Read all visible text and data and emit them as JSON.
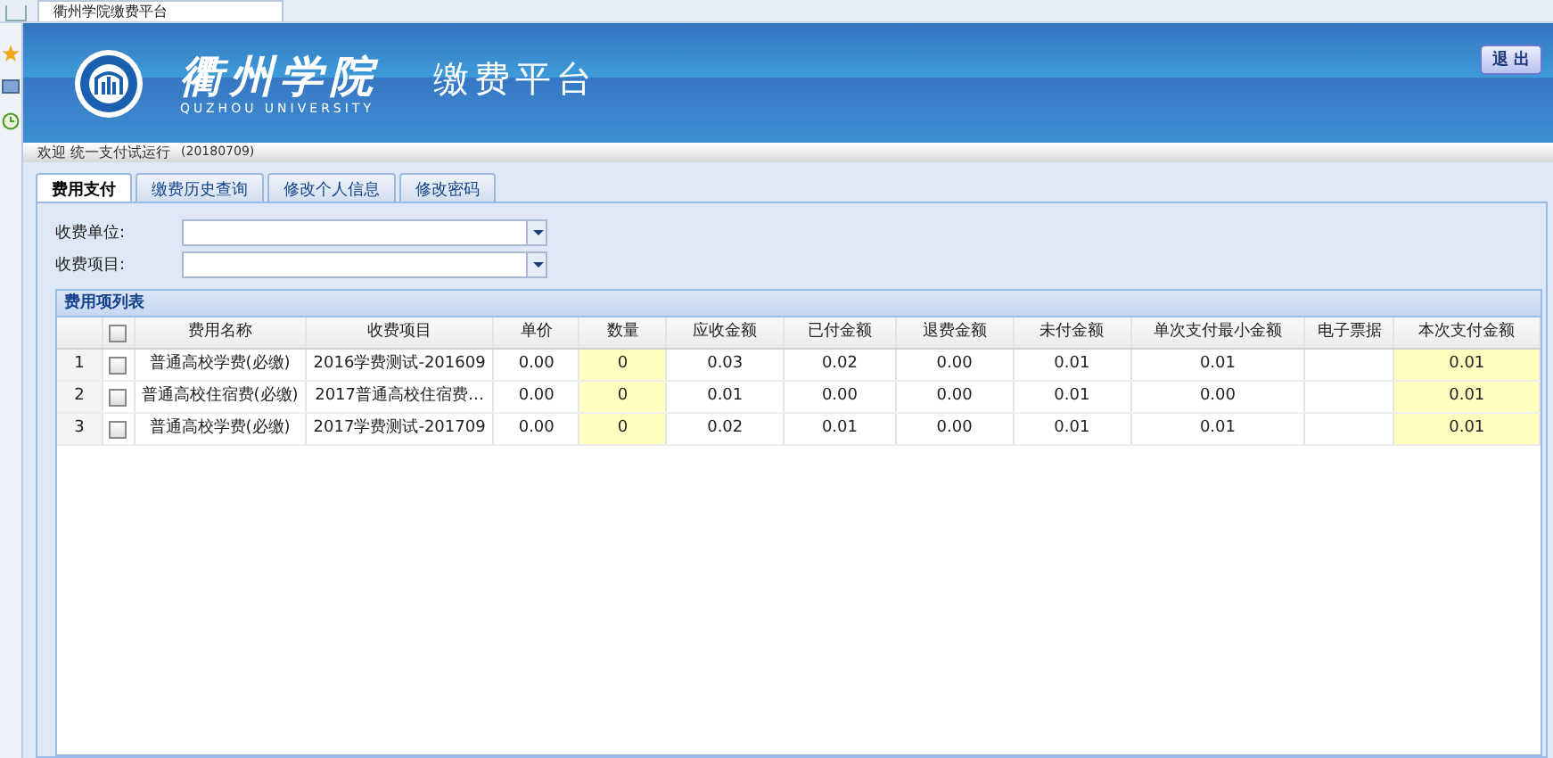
{
  "browser_tab": {
    "title": "衢州学院缴费平台"
  },
  "header": {
    "school_name": "衢州学院",
    "school_name_en": "QUZHOU  UNIVERSITY",
    "platform": "缴费平台",
    "logout": "退 出"
  },
  "welcome": {
    "text": "欢迎  统一支付试运行",
    "code": "(20180709)"
  },
  "tabs": [
    {
      "label": "费用支付",
      "selected": true
    },
    {
      "label": "缴费历史查询",
      "selected": false
    },
    {
      "label": "修改个人信息",
      "selected": false
    },
    {
      "label": "修改密码",
      "selected": false
    }
  ],
  "filters": [
    {
      "label": "收费单位:"
    },
    {
      "label": "收费项目:"
    }
  ],
  "table": {
    "title": "费用项列表",
    "select_all": false,
    "columns": [
      "费用名称",
      "收费项目",
      "单价",
      "数量",
      "应收金额",
      "已付金额",
      "退费金额",
      "未付金额",
      "单次支付最小金额",
      "电子票据",
      "本次支付金额"
    ],
    "rows": [
      {
        "index": "1",
        "checked": false,
        "cells": [
          "普通高校学费(必缴)",
          "2016学费测试-201609",
          "0.00",
          "0",
          "0.03",
          "0.02",
          "0.00",
          "0.01",
          "0.01",
          "",
          "0.01"
        ]
      },
      {
        "index": "2",
        "checked": false,
        "cells": [
          "普通高校住宿费(必缴)",
          "2017普通高校住宿费…",
          "0.00",
          "0",
          "0.01",
          "0.00",
          "0.00",
          "0.01",
          "0.00",
          "",
          "0.01"
        ]
      },
      {
        "index": "3",
        "checked": false,
        "cells": [
          "普通高校学费(必缴)",
          "2017学费测试-201709",
          "0.00",
          "0",
          "0.02",
          "0.01",
          "0.00",
          "0.01",
          "0.01",
          "",
          "0.01"
        ]
      }
    ]
  }
}
